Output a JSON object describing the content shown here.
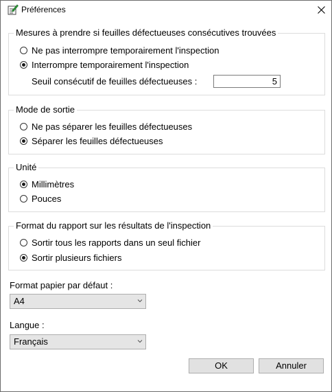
{
  "window": {
    "title": "Préférences"
  },
  "defect_group": {
    "title": "Mesures à prendre si feuilles défectueuses consécutives trouvées",
    "options": [
      {
        "label": "Ne pas interrompre temporairement l'inspection",
        "checked": false
      },
      {
        "label": "Interrompre temporairement l'inspection",
        "checked": true
      }
    ],
    "threshold_label": "Seuil consécutif de feuilles défectueuses :",
    "threshold_value": "5"
  },
  "output_group": {
    "title": "Mode de sortie",
    "options": [
      {
        "label": "Ne pas séparer les feuilles défectueuses",
        "checked": false
      },
      {
        "label": "Séparer les feuilles défectueuses",
        "checked": true
      }
    ]
  },
  "unit_group": {
    "title": "Unité",
    "options": [
      {
        "label": "Millimètres",
        "checked": true
      },
      {
        "label": "Pouces",
        "checked": false
      }
    ]
  },
  "report_group": {
    "title": "Format du rapport sur les résultats de l'inspection",
    "options": [
      {
        "label": "Sortir tous les rapports dans un seul fichier",
        "checked": false
      },
      {
        "label": "Sortir plusieurs fichiers",
        "checked": true
      }
    ]
  },
  "paper": {
    "label": "Format papier par défaut :",
    "value": "A4"
  },
  "language": {
    "label": "Langue :",
    "value": "Français"
  },
  "buttons": {
    "ok": "OK",
    "cancel": "Annuler"
  }
}
